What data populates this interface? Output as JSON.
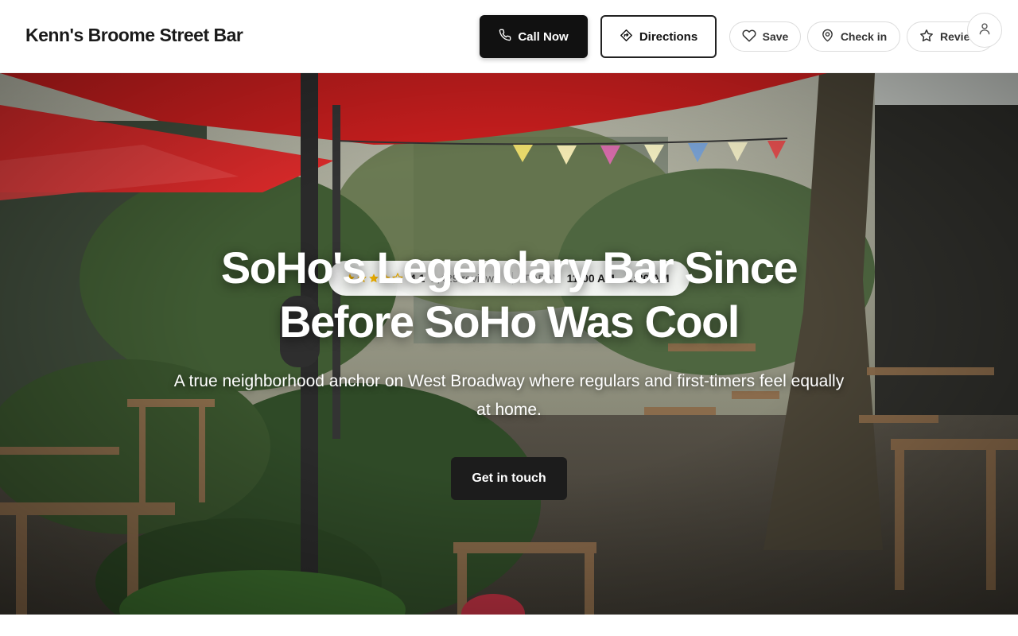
{
  "header": {
    "business_name": "Kenn's Broome Street Bar",
    "call_label": "Call Now",
    "directions_label": "Directions",
    "save_label": "Save",
    "checkin_label": "Check in",
    "review_label": "Review"
  },
  "hero": {
    "rating": "4.1",
    "stars": 4.1,
    "reviews": "1,429 reviews",
    "today_label": "TODAY",
    "hours": "11:00 AM – 1:30 AM",
    "headline": "SoHo's Legendary Bar Since Before SoHo Was Cool",
    "subhead": "A true neighborhood anchor on West Broadway where regulars and first-timers feel equally at home.",
    "cta_label": "Get in touch"
  },
  "icons": {
    "call": "phone-icon",
    "directions": "directions-icon",
    "save": "heart-icon",
    "checkin": "map-pin-icon",
    "review": "star-icon",
    "account": "user-icon"
  },
  "colors": {
    "primary_button": "#111111",
    "star_gold": "#f4b400",
    "umbrella_red": "#c81e1e"
  }
}
